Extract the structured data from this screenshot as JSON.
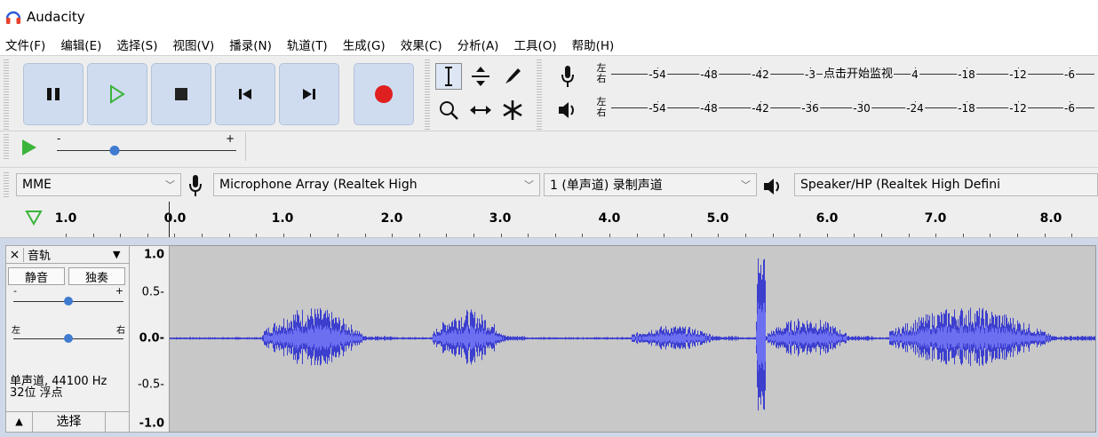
{
  "window": {
    "title": "Audacity",
    "app_icon": "headphones-icon"
  },
  "menu": [
    "文件(F)",
    "编辑(E)",
    "选择(S)",
    "视图(V)",
    "播录(N)",
    "轨道(T)",
    "生成(G)",
    "效果(C)",
    "分析(A)",
    "工具(O)",
    "帮助(H)"
  ],
  "transport": {
    "buttons": [
      {
        "name": "pause",
        "icon": "pause-icon"
      },
      {
        "name": "play",
        "icon": "play-icon"
      },
      {
        "name": "stop",
        "icon": "stop-icon"
      },
      {
        "name": "skip-start",
        "icon": "skip-to-start-icon"
      },
      {
        "name": "skip-end",
        "icon": "skip-to-end-icon"
      },
      {
        "name": "record",
        "icon": "record-icon"
      }
    ]
  },
  "tools": [
    "selection-tool-icon",
    "envelope-tool-icon",
    "draw-tool-icon",
    "zoom-tool-icon",
    "time-shift-tool-icon",
    "multi-tool-icon"
  ],
  "meters": {
    "record": {
      "lr_top": "左",
      "lr_bottom": "右",
      "ticks": [
        "-54",
        "-48",
        "-42",
        "-3",
        "4",
        "-18",
        "-12",
        "-6"
      ],
      "prompt": "点击开始监视"
    },
    "playback": {
      "lr_top": "左",
      "lr_bottom": "右",
      "ticks": [
        "-54",
        "-48",
        "-42",
        "-36",
        "-30",
        "-24",
        "-18",
        "-12",
        "-6"
      ]
    }
  },
  "play_at_speed": {
    "minus": "-",
    "plus": "+",
    "speed_fraction": 0.33
  },
  "device": {
    "host": "MME",
    "recording_device": "Microphone Array (Realtek High",
    "channels": "1 (单声道) 录制声道",
    "playback_device": "Speaker/HP (Realtek High Defini"
  },
  "timeline": {
    "labels": [
      "1.0",
      "0.0",
      "1.0",
      "2.0",
      "3.0",
      "4.0",
      "5.0",
      "6.0",
      "7.0",
      "8.0"
    ]
  },
  "track": {
    "close": "×",
    "name": "音轨",
    "menu_arrow": "▼",
    "mute": "静音",
    "solo": "独奏",
    "gain": {
      "minus": "-",
      "plus": "+",
      "value_fraction": 0.5
    },
    "pan": {
      "left": "左",
      "right": "右",
      "value_fraction": 0.5
    },
    "info_line1": "单声道, 44100 Hz",
    "info_line2": "32位 浮点",
    "collapse": "▲",
    "select": "选择"
  },
  "vertical_ruler": [
    "1.0",
    "0.5-",
    "0.0-",
    "-0.5-",
    "-1.0"
  ],
  "colors": {
    "waveform": "#3c3fce",
    "waveform_rms": "#6c6ff0",
    "wave_bg": "#c8c8c8",
    "record_red": "#e02020",
    "play_green": "#3bb43b",
    "button_bg": "#cfdcf0"
  }
}
